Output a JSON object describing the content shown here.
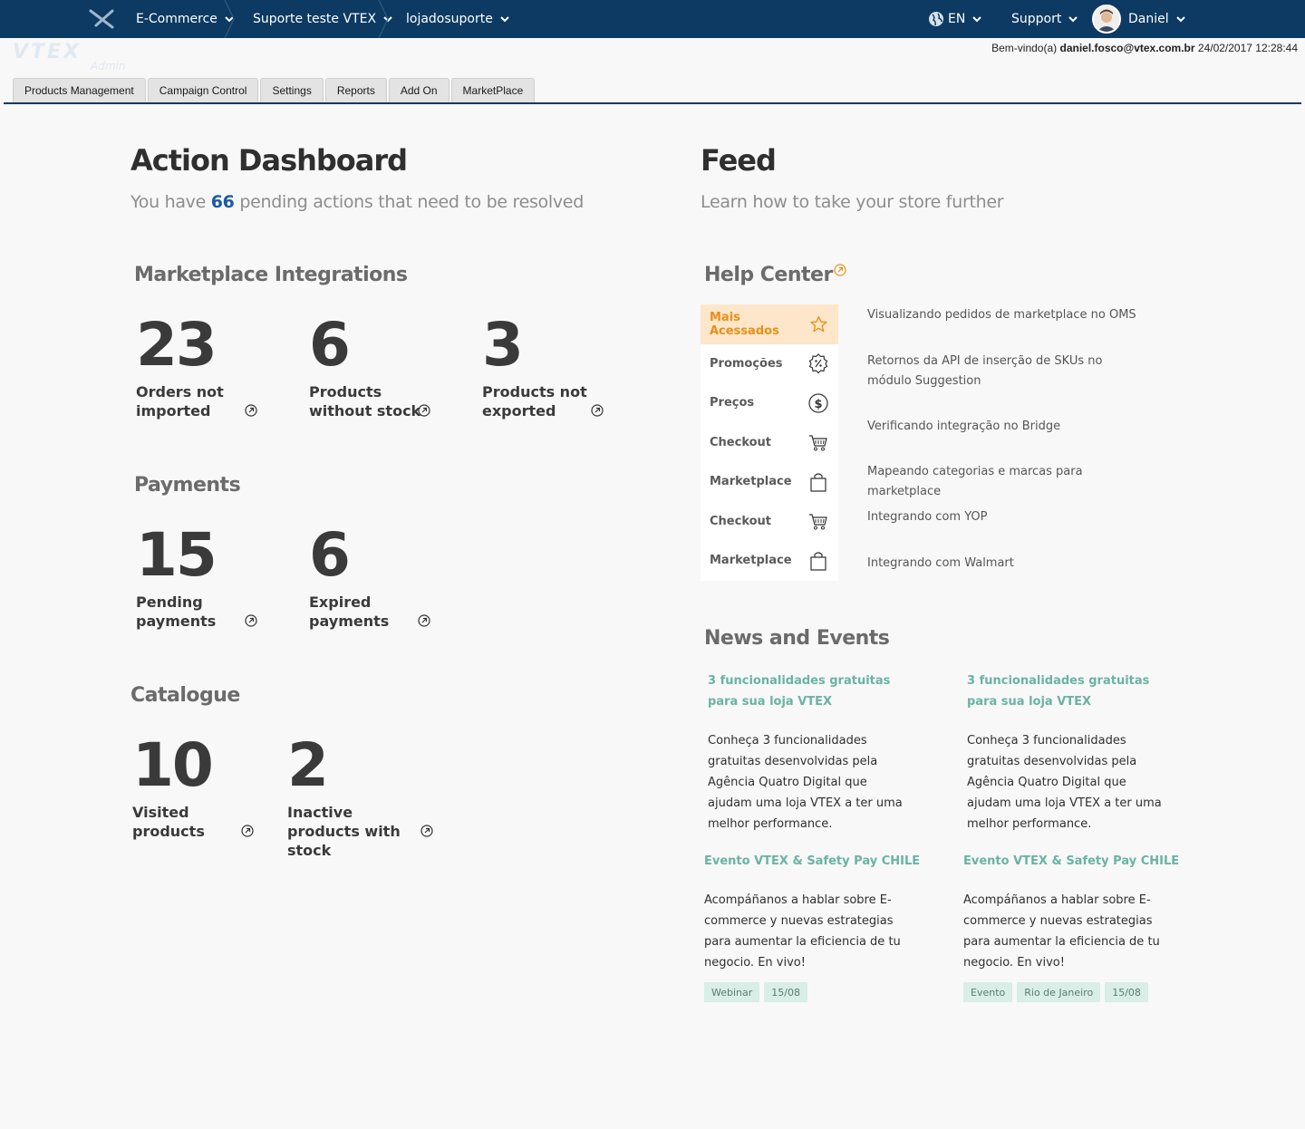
{
  "topbar": {
    "breadcrumbs": [
      "E-Commerce",
      "Suporte teste VTEX",
      "lojadosuporte"
    ],
    "language": "EN",
    "support": "Support",
    "user": "Daniel"
  },
  "header": {
    "logo_text": "VTEX",
    "logo_sub": "Admin",
    "welcome_prefix": "Bem-vindo(a) ",
    "welcome_email": "daniel.fosco@vtex.com.br",
    "welcome_datetime": " 24/02/2017 12:28:44"
  },
  "tabs": [
    "Products Management",
    "Campaign Control",
    "Settings",
    "Reports",
    "Add On",
    "MarketPlace"
  ],
  "dashboard": {
    "title": "Action Dashboard",
    "subtitle_pre": "You have ",
    "pending_count": "66",
    "subtitle_post": " pending actions that need to be resolved",
    "sections": {
      "marketplace": {
        "title": "Marketplace Integrations",
        "metrics": [
          {
            "value": "23",
            "label": "Orders not imported"
          },
          {
            "value": "6",
            "label": "Products without stock"
          },
          {
            "value": "3",
            "label": "Products not exported"
          }
        ]
      },
      "payments": {
        "title": "Payments",
        "metrics": [
          {
            "value": "15",
            "label": "Pending payments"
          },
          {
            "value": "6",
            "label": "Expired payments"
          }
        ]
      },
      "catalogue": {
        "title": "Catalogue",
        "metrics": [
          {
            "value": "10",
            "label": "Visited products"
          },
          {
            "value": "2",
            "label": "Inactive products with stock"
          }
        ]
      }
    }
  },
  "feed": {
    "title": "Feed",
    "subtitle": "Learn how to take your store further",
    "help_center": {
      "title": "Help Center",
      "menu": [
        {
          "label": "Mais Acessados",
          "icon": "star-icon"
        },
        {
          "label": "Promoções",
          "icon": "percent-badge-icon"
        },
        {
          "label": "Preços",
          "icon": "dollar-icon"
        },
        {
          "label": "Checkout",
          "icon": "cart-icon"
        },
        {
          "label": "Marketplace",
          "icon": "bag-icon"
        },
        {
          "label": "Checkout",
          "icon": "cart-icon"
        },
        {
          "label": "Marketplace",
          "icon": "bag-icon"
        }
      ],
      "links": [
        "Visualizando pedidos de marketplace no OMS",
        "Retornos da API de inserção de SKUs no módulo Suggestion",
        "Verificando integração no Bridge",
        "Mapeando categorias e marcas para marketplace",
        "Integrando com YOP",
        "Integrando com Walmart"
      ]
    },
    "news": {
      "title": "News and Events",
      "items": [
        {
          "title": "3 funcionalidades gratuitas para sua loja VTEX",
          "body": "Conheça 3 funcionalidades gratuitas desenvolvidas pela Agência Quatro Digital que ajudam uma loja VTEX a ter uma melhor performance.",
          "tags": []
        },
        {
          "title": "3 funcionalidades gratuitas para sua loja VTEX",
          "body": "Conheça 3 funcionalidades gratuitas desenvolvidas pela Agência Quatro Digital que ajudam uma loja VTEX a ter uma melhor performance.",
          "tags": []
        },
        {
          "title": "Evento VTEX & Safety Pay CHILE",
          "body": "Acompáñanos a hablar sobre E-commerce y nuevas estrategias para aumentar la eficiencia de tu negocio. En vivo!",
          "tags": [
            "Webinar",
            "15/08"
          ]
        },
        {
          "title": "Evento VTEX & Safety Pay CHILE",
          "body": "Acompáñanos a hablar sobre E-commerce y nuevas estrategias para aumentar la eficiencia de tu negocio. En vivo!",
          "tags": [
            "Evento",
            "Rio de Janeiro",
            "15/08"
          ]
        }
      ]
    }
  },
  "colors": {
    "topbar": "#0c3a62",
    "accent_blue": "#1c5aa8",
    "accent_orange": "#e8901a",
    "news_green": "#6ab3a3",
    "tag_bg": "#d8eee7"
  }
}
